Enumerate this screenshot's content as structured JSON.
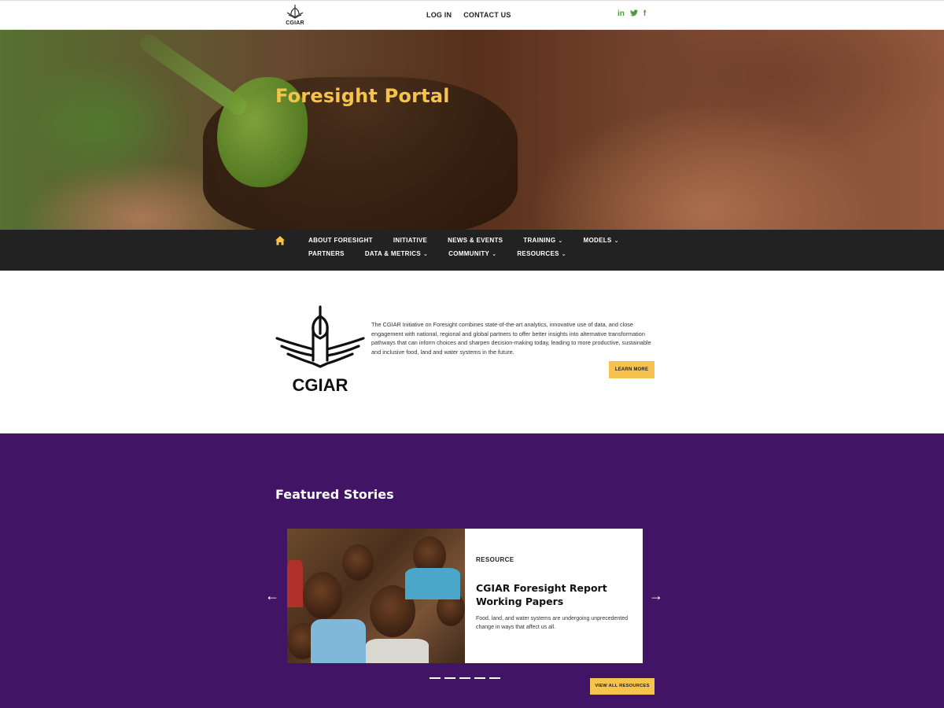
{
  "header": {
    "logo_text": "CGIAR",
    "links": [
      {
        "label": "LOG IN"
      },
      {
        "label": "CONTACT US"
      }
    ],
    "social": [
      {
        "label": "in",
        "icon": "linkedin-icon"
      },
      {
        "label": "🐦",
        "icon": "twitter-icon"
      },
      {
        "label": "f",
        "icon": "facebook-icon"
      }
    ]
  },
  "hero": {
    "title": "Foresight Portal"
  },
  "nav": {
    "row1": [
      {
        "label": "ABOUT FORESIGHT",
        "dropdown": false
      },
      {
        "label": "INITIATIVE",
        "dropdown": false
      },
      {
        "label": "NEWS & EVENTS",
        "dropdown": false
      },
      {
        "label": "TRAINING",
        "dropdown": true
      },
      {
        "label": "MODELS",
        "dropdown": true
      }
    ],
    "row2": [
      {
        "label": "PARTNERS",
        "dropdown": false
      },
      {
        "label": "DATA & METRICS",
        "dropdown": true
      },
      {
        "label": "COMMUNITY",
        "dropdown": true
      },
      {
        "label": "RESOURCES",
        "dropdown": true
      }
    ]
  },
  "intro": {
    "logo_text": "CGIAR",
    "text": "The CGIAR Initiative on Foresight combines state-of-the-art analytics, innovative use of data, and close engagement with national, regional and global partners to offer better insights into alternative transformation pathways that can inform choices and sharpen decision-making today, leading to more productive, sustainable and inclusive food, land and water systems in the future.",
    "button": "LEARN MORE"
  },
  "featured": {
    "title": "Featured Stories",
    "card": {
      "tag": "RESOURCE",
      "title": "CGIAR Foresight Report Working Papers",
      "description": "Food, land, and water systems are undergoing unprecedented change in ways that affect us all."
    },
    "prev": "←",
    "next": "→",
    "dot_count": 5,
    "view_all": "VIEW ALL RESOURCES"
  },
  "colors": {
    "accent_yellow": "#f6c34f",
    "hero_title": "#f5c34b",
    "nav_bg": "#222222",
    "featured_bg": "#421465",
    "social_green": "#4a9b3b"
  }
}
